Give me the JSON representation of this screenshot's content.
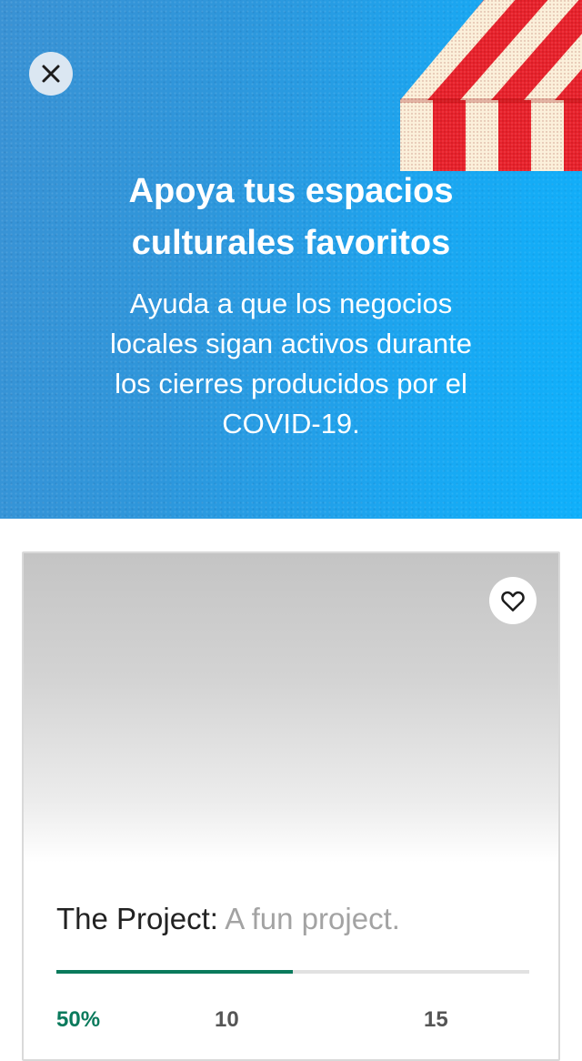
{
  "hero": {
    "title_line1": "Apoya tus espacios",
    "title_line2": "culturales favoritos",
    "subtitle_line1": "Ayuda a que los negocios",
    "subtitle_line2": "locales sigan activos durante",
    "subtitle_line3": "los cierres producidos por el",
    "subtitle_line4": "COVID-19.",
    "close_icon": "close-icon",
    "colors": {
      "background_start": "#3a92d4",
      "background_end": "#0fb0fb",
      "awning_red": "#e8232d",
      "awning_cream": "#fbefd9"
    }
  },
  "project_card": {
    "favorite_icon": "heart-outline-icon",
    "name": "The Project:",
    "blurb": "A fun project.",
    "progress_fraction": 0.5,
    "stats": {
      "percent_funded": "50%",
      "value_a": "10",
      "value_b": "15"
    },
    "colors": {
      "accent": "#0a7a5c"
    }
  }
}
